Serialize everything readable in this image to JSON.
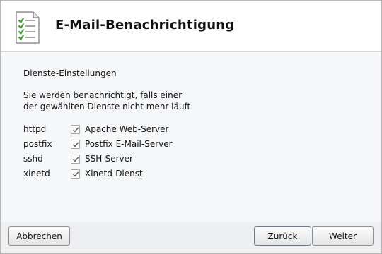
{
  "header": {
    "title": "E-Mail-Benachrichtigung",
    "icon": "checklist-icon"
  },
  "content": {
    "section_title": "Dienste-Einstellungen",
    "description_line1": "Sie werden benachrichtigt, falls einer",
    "description_line2": "der gewählten Dienste nicht mehr läuft",
    "services": [
      {
        "name": "httpd",
        "label": "Apache Web-Server",
        "checked": true
      },
      {
        "name": "postfix",
        "label": "Postfix E-Mail-Server",
        "checked": true
      },
      {
        "name": "sshd",
        "label": "SSH-Server",
        "checked": true
      },
      {
        "name": "xinetd",
        "label": "Xinetd-Dienst",
        "checked": true
      }
    ]
  },
  "footer": {
    "cancel_label": "Abbrechen",
    "back_label": "Zurück",
    "next_label": "Weiter"
  }
}
